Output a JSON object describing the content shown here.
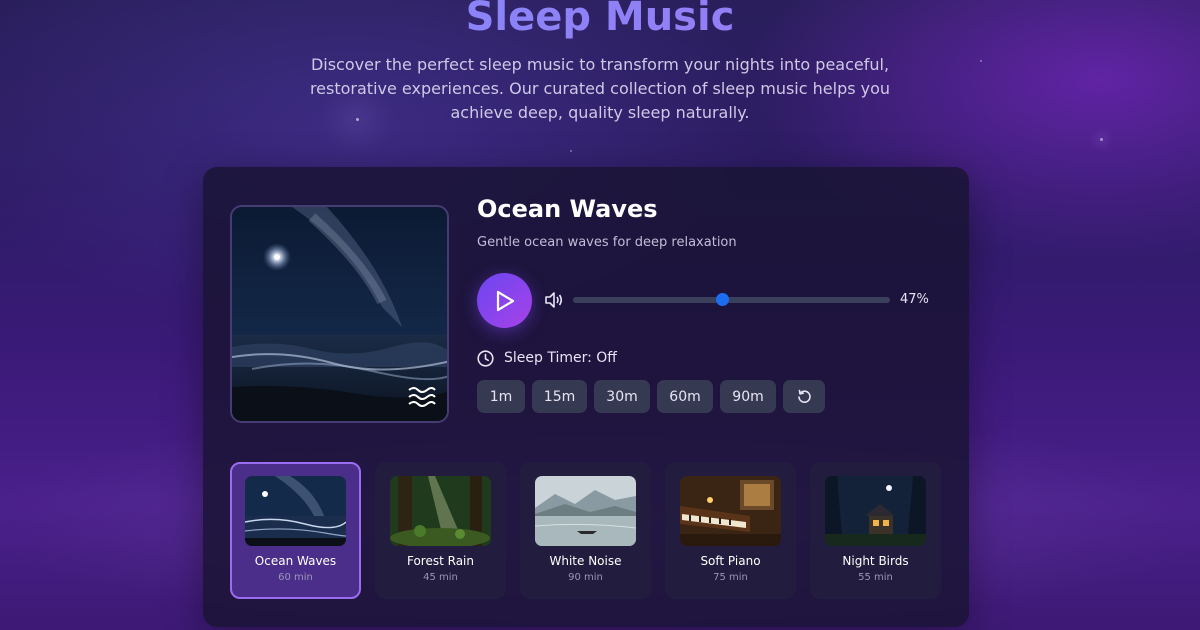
{
  "page": {
    "title": "Sleep Music",
    "description": "Discover the perfect sleep music to transform your nights into peaceful, restorative experiences. Our curated collection of sleep music helps you achieve deep, quality sleep naturally."
  },
  "player": {
    "track_title": "Ocean Waves",
    "track_subtitle": "Gentle ocean waves for deep relaxation",
    "volume_percent": 47,
    "volume_label": "47%",
    "timer_label": "Sleep Timer: Off",
    "timer_options": [
      "1m",
      "15m",
      "30m",
      "60m",
      "90m"
    ],
    "icons": [
      "play-icon",
      "volume-icon",
      "clock-icon",
      "reset-icon",
      "waves-icon"
    ]
  },
  "tracks": [
    {
      "name": "Ocean Waves",
      "duration": "60 min",
      "active": true
    },
    {
      "name": "Forest Rain",
      "duration": "45 min",
      "active": false
    },
    {
      "name": "White Noise",
      "duration": "90 min",
      "active": false
    },
    {
      "name": "Soft Piano",
      "duration": "75 min",
      "active": false
    },
    {
      "name": "Night Birds",
      "duration": "55 min",
      "active": false
    }
  ],
  "colors": {
    "accent": "#8b7cf6",
    "play_gradient_start": "#6b46f0",
    "play_gradient_end": "#a742e8",
    "slider_thumb": "#1d6df2",
    "active_card": "#4a2e8a"
  }
}
